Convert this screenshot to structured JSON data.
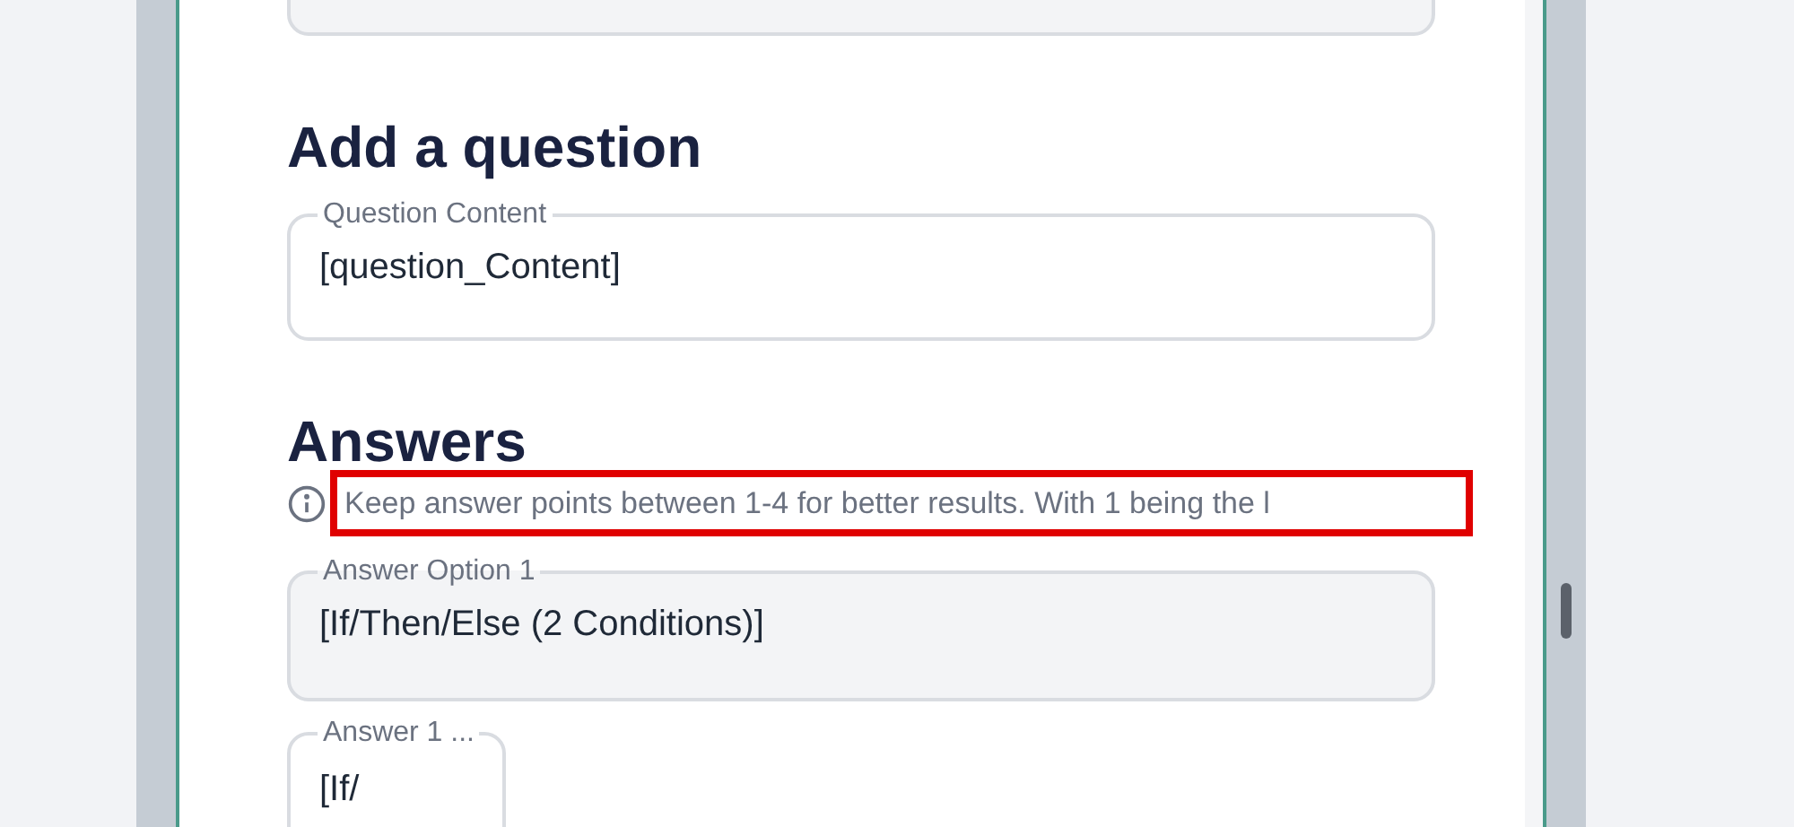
{
  "question_section": {
    "heading": "Add a question",
    "field": {
      "label": "Question Content",
      "value": "[question_Content]",
      "filled": false
    }
  },
  "answers_section": {
    "heading": "Answers",
    "hint": "Keep answer points between 1-4 for better results. With 1 being the l",
    "hint_highlighted": true,
    "options": [
      {
        "label": "Answer Option 1",
        "value": "[If/Then/Else (2 Conditions)]",
        "filled": true,
        "kind": "wide"
      },
      {
        "label": "Answer 1 ...",
        "value": "[If/",
        "filled": false,
        "kind": "narrow"
      }
    ]
  }
}
